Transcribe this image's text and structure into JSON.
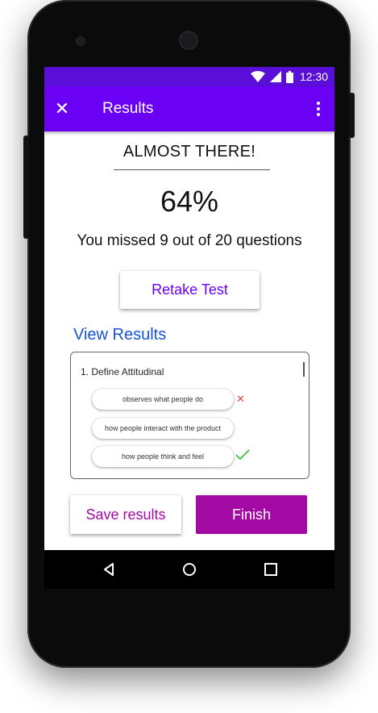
{
  "status_bar": {
    "time": "12:30",
    "icons": [
      "wifi-icon",
      "cell-signal-icon",
      "battery-icon"
    ]
  },
  "app_bar": {
    "title": "Results",
    "close_icon": "close-icon",
    "menu_icon": "more-vert-icon"
  },
  "summary": {
    "headline": "ALMOST THERE!",
    "percent": "64%",
    "missed_text": "You missed 9 out of 20 questions"
  },
  "retake_label": "Retake Test",
  "view_results_label": "View Results",
  "results": {
    "question": "1. Define Attitudinal",
    "answers": [
      {
        "text": "observes what people do",
        "status": "wrong"
      },
      {
        "text": "how people interact with the product",
        "status": "none"
      },
      {
        "text": "how people think and feel",
        "status": "correct"
      }
    ]
  },
  "actions": {
    "save_label": "Save results",
    "finish_label": "Finish"
  },
  "colors": {
    "status_bar": "#5a0fd8",
    "app_bar": "#6a00f4",
    "accent_purple": "#6a00f4",
    "link_blue": "#1553d6",
    "finish_magenta": "#a20aa3",
    "wrong_red": "#e0483b",
    "correct_green": "#2fbd3a"
  },
  "nav_bar": {
    "icons": [
      "back-icon",
      "home-icon",
      "recents-icon"
    ]
  }
}
